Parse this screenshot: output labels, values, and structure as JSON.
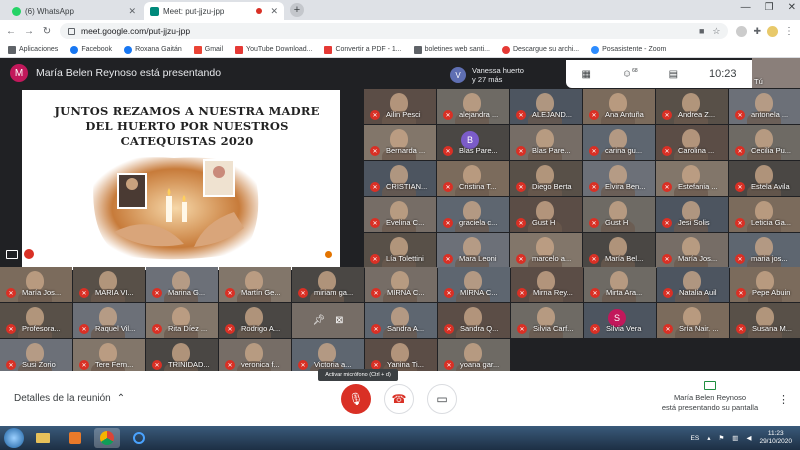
{
  "browser": {
    "tabs": [
      {
        "label": "(6) WhatsApp",
        "active": false,
        "favicon_color": "#25d366"
      },
      {
        "label": "Meet: put-jjzu-jpp",
        "active": true,
        "favicon_color": "#00897b"
      }
    ],
    "new_tab_label": "+",
    "window_controls": [
      "—",
      "❐",
      "✕"
    ],
    "url": "meet.google.com/put-jjzu-jpp",
    "bookmarks": [
      {
        "label": "Aplicaciones",
        "color": "#5f6368"
      },
      {
        "label": "Facebook",
        "color": "#1877f2"
      },
      {
        "label": "Roxana Gaitán",
        "color": "#1877f2"
      },
      {
        "label": "Gmail",
        "color": "#ea4335"
      },
      {
        "label": "YouTube Download...",
        "color": "#e53935"
      },
      {
        "label": "Convertir a PDF - 1...",
        "color": "#e53935"
      },
      {
        "label": "boletines web santi...",
        "color": "#5f6368"
      },
      {
        "label": "Descargue su archi...",
        "color": "#e53935"
      },
      {
        "label": "Posasistente - Zoom",
        "color": "#2d8cff"
      }
    ]
  },
  "meet": {
    "presenter_initial": "M",
    "presenter_text": "María Belen Reynoso está presentando",
    "slide_title": "JUNTOS REZAMOS A NUESTRA MADRE DEL HUERTO POR NUESTROS CATEQUISTAS 2020",
    "slide_footer_name": "María Belen Reynoso",
    "join_popup": {
      "initial": "V",
      "line1": "Vanessa huerto",
      "line2": "y 27 más"
    },
    "participant_badge": "68",
    "clock": "10:23",
    "top_right_label": "Tú",
    "participants_right": [
      [
        "Ailin Pesci",
        "alejandra ...",
        "ALEJAND...",
        "Ana Antuña",
        "Andrea Z...",
        "antonela ..."
      ],
      [
        "Bernarda ...",
        "Blas Pare...",
        "Blas Pare...",
        "carina gu...",
        "Carolina ...",
        "Cecilia Pu..."
      ],
      [
        "CRISTIAN...",
        "Cristina T...",
        "Diego Berta",
        "Elvira Ben...",
        "Estefania ...",
        "Estela Avila"
      ],
      [
        "Evelina C...",
        "graciela c...",
        "Gust H",
        "Gust H",
        "Jesi Solis",
        "Leticia Ga..."
      ],
      [
        "Lía Tolettini",
        "Mara Leoni",
        "marcelo a...",
        "María Bel...",
        "María Jos...",
        "maria jos..."
      ]
    ],
    "participants_wide": [
      [
        "María Jos...",
        "MARIA VI...",
        "Marina G...",
        "Martín Ge...",
        "miriam ga...",
        "MIRNA C...",
        "MIRNA C...",
        "Mirna Rey...",
        "Mirta Ara...",
        "Natalia Auil",
        "Pepe Abuin"
      ],
      [
        "Profesora...",
        "Raquel Vil...",
        "Rita Díez ...",
        "Rodrigo A...",
        "",
        "Sandra A...",
        "Sandra Q...",
        "Silvia Carf...",
        "Silvia Vera",
        "Sría Nair. ...",
        "Susana M..."
      ],
      [
        "Susi Zorio",
        "Tere Fern...",
        "TRINIDAD...",
        "veronica f...",
        "Victoria a...",
        "Yanina Ti...",
        "yoana gar..."
      ]
    ],
    "initials": {
      "Blas": "B",
      "Natalia": "N",
      "Silvia": "S"
    }
  },
  "bottom": {
    "details_label": "Detalles de la reunión",
    "tooltip": "Activar micrófono (Ctrl + d)",
    "presenting_line1": "María Belen Reynoso",
    "presenting_line2": "está presentando su pantalla"
  },
  "taskbar": {
    "lang": "ES",
    "time": "11:23",
    "date": "29/10/2020"
  }
}
